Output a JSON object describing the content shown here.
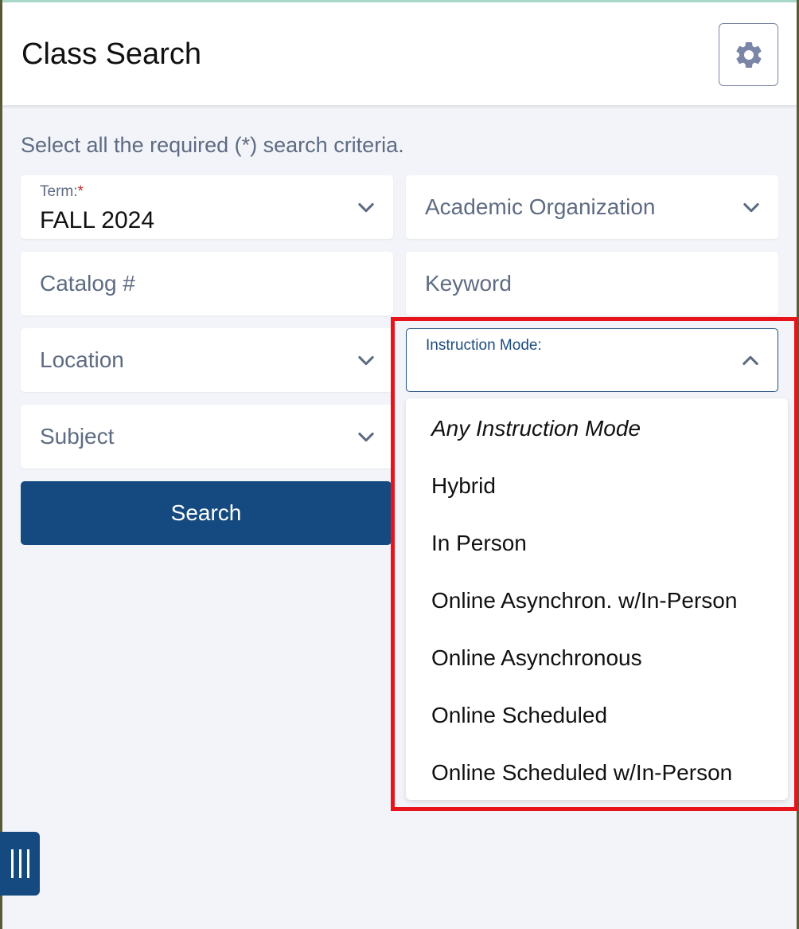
{
  "header": {
    "title": "Class Search",
    "settings_icon": "gear-icon"
  },
  "instructions": "Select all the required (*) search criteria.",
  "fields": {
    "term": {
      "label": "Term:",
      "required_marker": "*",
      "value": "FALL 2024"
    },
    "academic_organization": {
      "placeholder": "Academic Organization"
    },
    "catalog": {
      "placeholder": "Catalog #"
    },
    "keyword": {
      "placeholder": "Keyword"
    },
    "location": {
      "placeholder": "Location"
    },
    "instruction_mode": {
      "label": "Instruction Mode:",
      "value": ""
    },
    "subject": {
      "placeholder": "Subject"
    }
  },
  "search_button": {
    "label": "Search"
  },
  "instruction_mode_options": [
    "Any Instruction Mode",
    "Hybrid",
    "In Person",
    "Online Asynchron. w/In-Person",
    "Online Asynchronous",
    "Online Scheduled",
    "Online Scheduled w/In-Person"
  ],
  "colors": {
    "primary": "#154a80",
    "page_bg": "#f2f4f9",
    "muted_text": "#5e6b82",
    "required": "#c0292c",
    "highlight": "#e8141c"
  }
}
